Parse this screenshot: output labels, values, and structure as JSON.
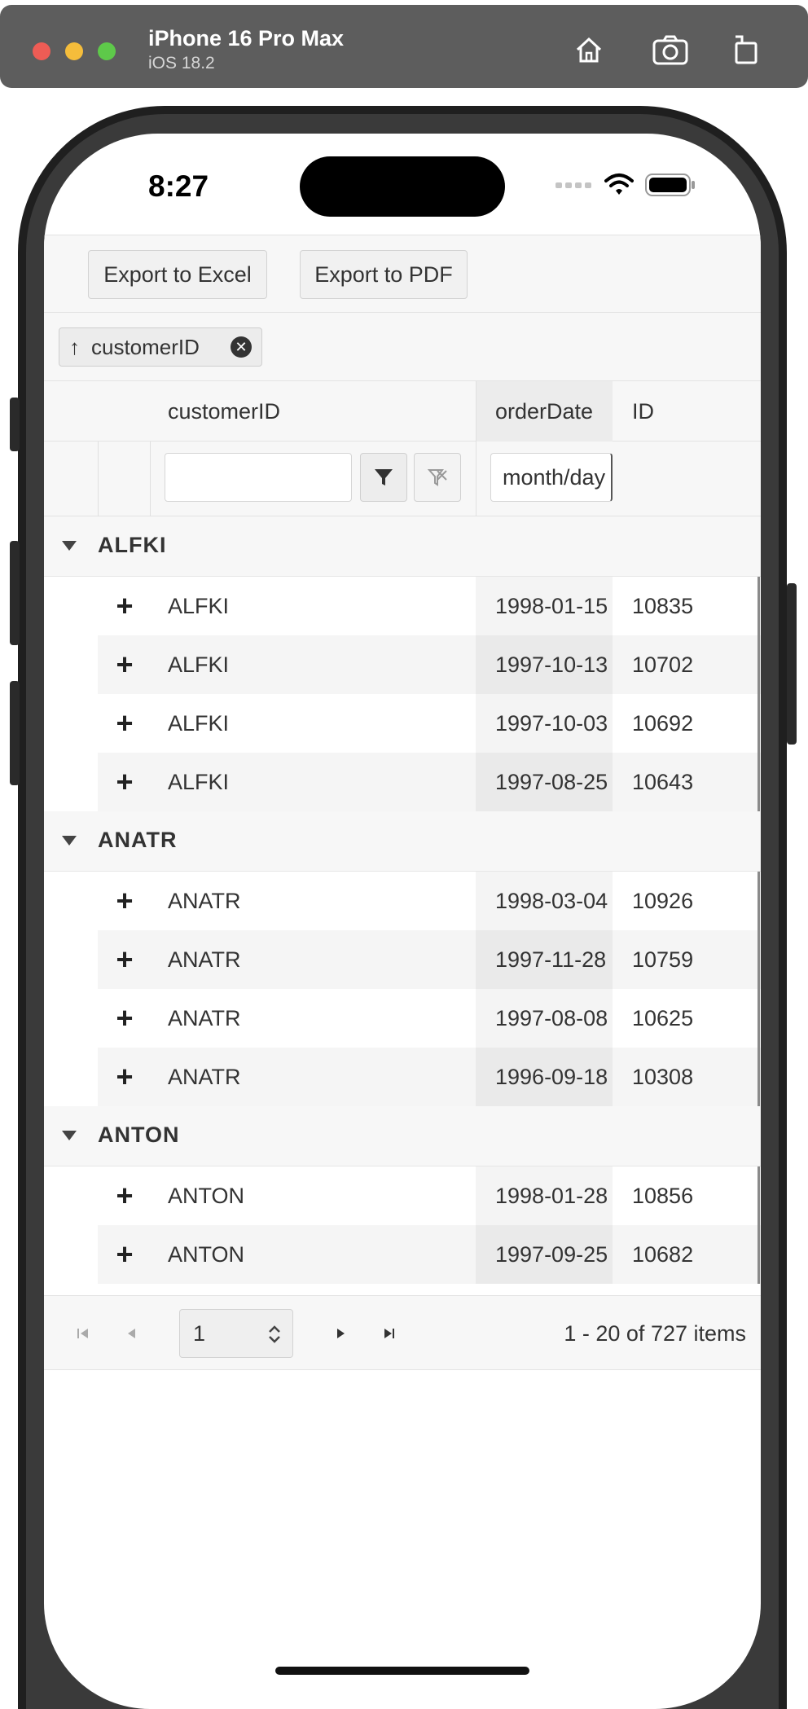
{
  "simulator": {
    "device_name": "iPhone 16 Pro Max",
    "os_version": "iOS 18.2"
  },
  "status_bar": {
    "time": "8:27"
  },
  "toolbar": {
    "export_excel_label": "Export to Excel",
    "export_pdf_label": "Export to PDF"
  },
  "group_panel": {
    "chip_label": "customerID",
    "chip_sort_icon": "↑"
  },
  "columns": {
    "customer_id": "customerID",
    "order_date": "orderDate",
    "id": "ID"
  },
  "filters": {
    "customer_id_value": "",
    "order_date_placeholder": "month/day"
  },
  "groups": [
    {
      "name": "ALFKI",
      "rows": [
        {
          "customer": "ALFKI",
          "date": "1998-01-15",
          "id": "10835"
        },
        {
          "customer": "ALFKI",
          "date": "1997-10-13",
          "id": "10702"
        },
        {
          "customer": "ALFKI",
          "date": "1997-10-03",
          "id": "10692"
        },
        {
          "customer": "ALFKI",
          "date": "1997-08-25",
          "id": "10643"
        }
      ]
    },
    {
      "name": "ANATR",
      "rows": [
        {
          "customer": "ANATR",
          "date": "1998-03-04",
          "id": "10926"
        },
        {
          "customer": "ANATR",
          "date": "1997-11-28",
          "id": "10759"
        },
        {
          "customer": "ANATR",
          "date": "1997-08-08",
          "id": "10625"
        },
        {
          "customer": "ANATR",
          "date": "1996-09-18",
          "id": "10308"
        }
      ]
    },
    {
      "name": "ANTON",
      "rows": [
        {
          "customer": "ANTON",
          "date": "1998-01-28",
          "id": "10856"
        },
        {
          "customer": "ANTON",
          "date": "1997-09-25",
          "id": "10682"
        }
      ]
    }
  ],
  "pager": {
    "current_page": "1",
    "info": "1 - 20 of 727 items"
  },
  "icons": {
    "expand_row": "+",
    "group_collapse": "caret-down-icon"
  }
}
